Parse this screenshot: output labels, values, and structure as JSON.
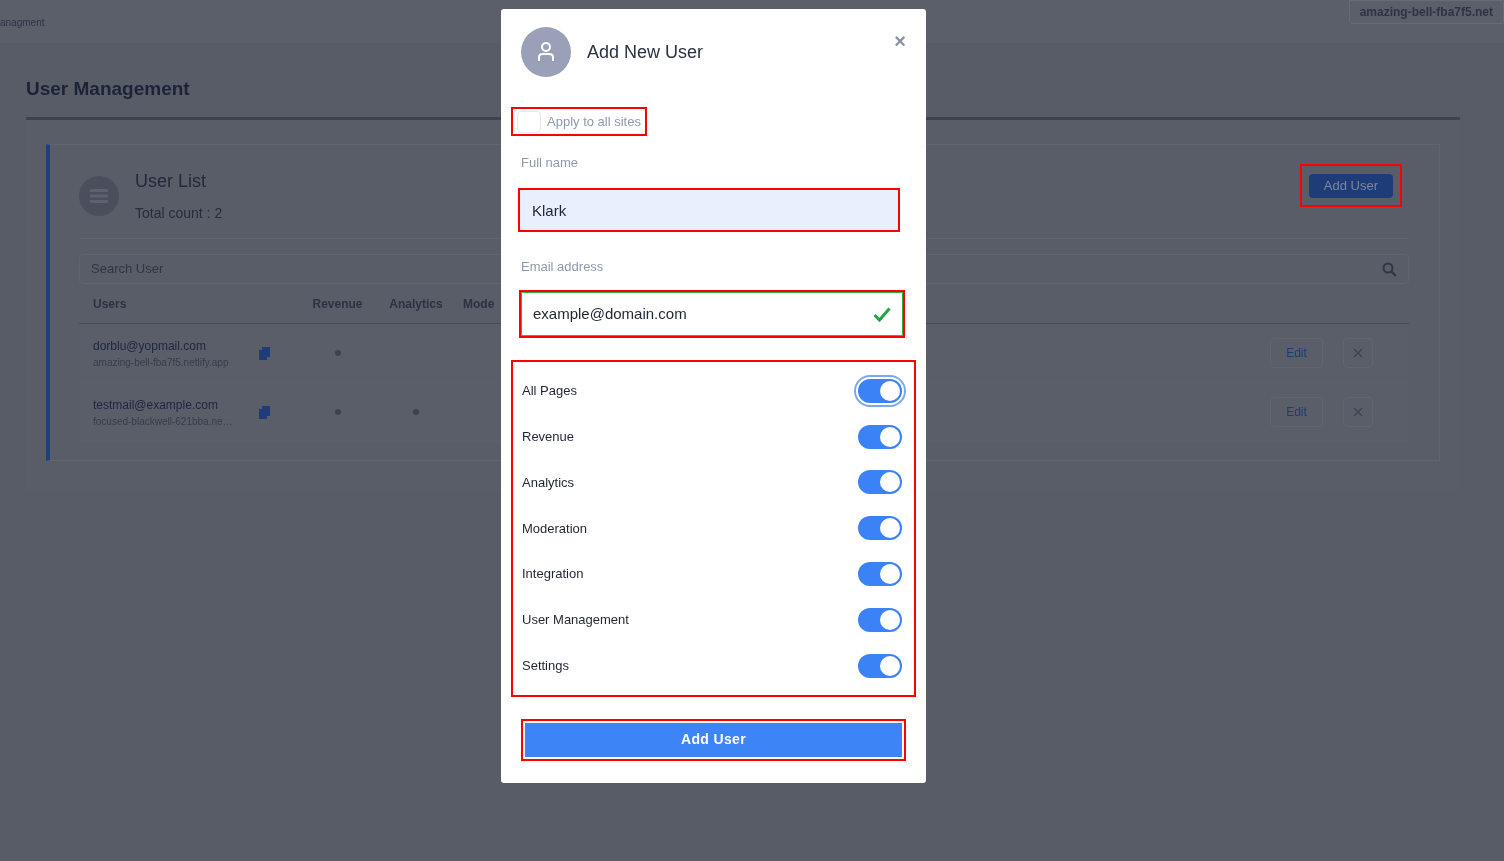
{
  "top_bar": {
    "breadcrumb": "anagment",
    "site_selector": "amazing-bell-fba7f5.net"
  },
  "page_title": "User Management",
  "user_list": {
    "title": "User List",
    "total_count": "Total count : 2",
    "add_button": {
      "label": "Add User",
      "highlighted": true
    },
    "search": {
      "placeholder": "Search User"
    },
    "columns": [
      "Users",
      "Revenue",
      "Analytics",
      "Mode"
    ],
    "rows": [
      {
        "email": "dorblu@yopmail.com",
        "site": "amazing-bell-fba7f5.netlify.app",
        "permissions": [
          true,
          false
        ],
        "edit": "Edit"
      },
      {
        "email": "testmail@example.com",
        "site": "focused-blackwell-621bba.ne…",
        "permissions": [
          true,
          true
        ],
        "edit": "Edit"
      }
    ]
  },
  "dialog": {
    "title": "Add New User",
    "close": "×",
    "apply_all": {
      "label": "Apply to all sites",
      "checked": false,
      "highlighted": true
    },
    "full_name": {
      "label": "Full name",
      "value": "Klark",
      "highlighted": true
    },
    "email": {
      "label": "Email address",
      "value": "example@domain.com",
      "valid": true,
      "highlighted": true
    },
    "permissions_highlighted": true,
    "permissions": [
      {
        "label": "All Pages",
        "on": true,
        "focused": true
      },
      {
        "label": "Revenue",
        "on": true,
        "focused": false
      },
      {
        "label": "Analytics",
        "on": true,
        "focused": false
      },
      {
        "label": "Moderation",
        "on": true,
        "focused": false
      },
      {
        "label": "Integration",
        "on": true,
        "focused": false
      },
      {
        "label": "User Management",
        "on": true,
        "focused": false
      },
      {
        "label": "Settings",
        "on": true,
        "focused": false
      }
    ],
    "submit": {
      "label": "Add User",
      "highlighted": true
    }
  }
}
